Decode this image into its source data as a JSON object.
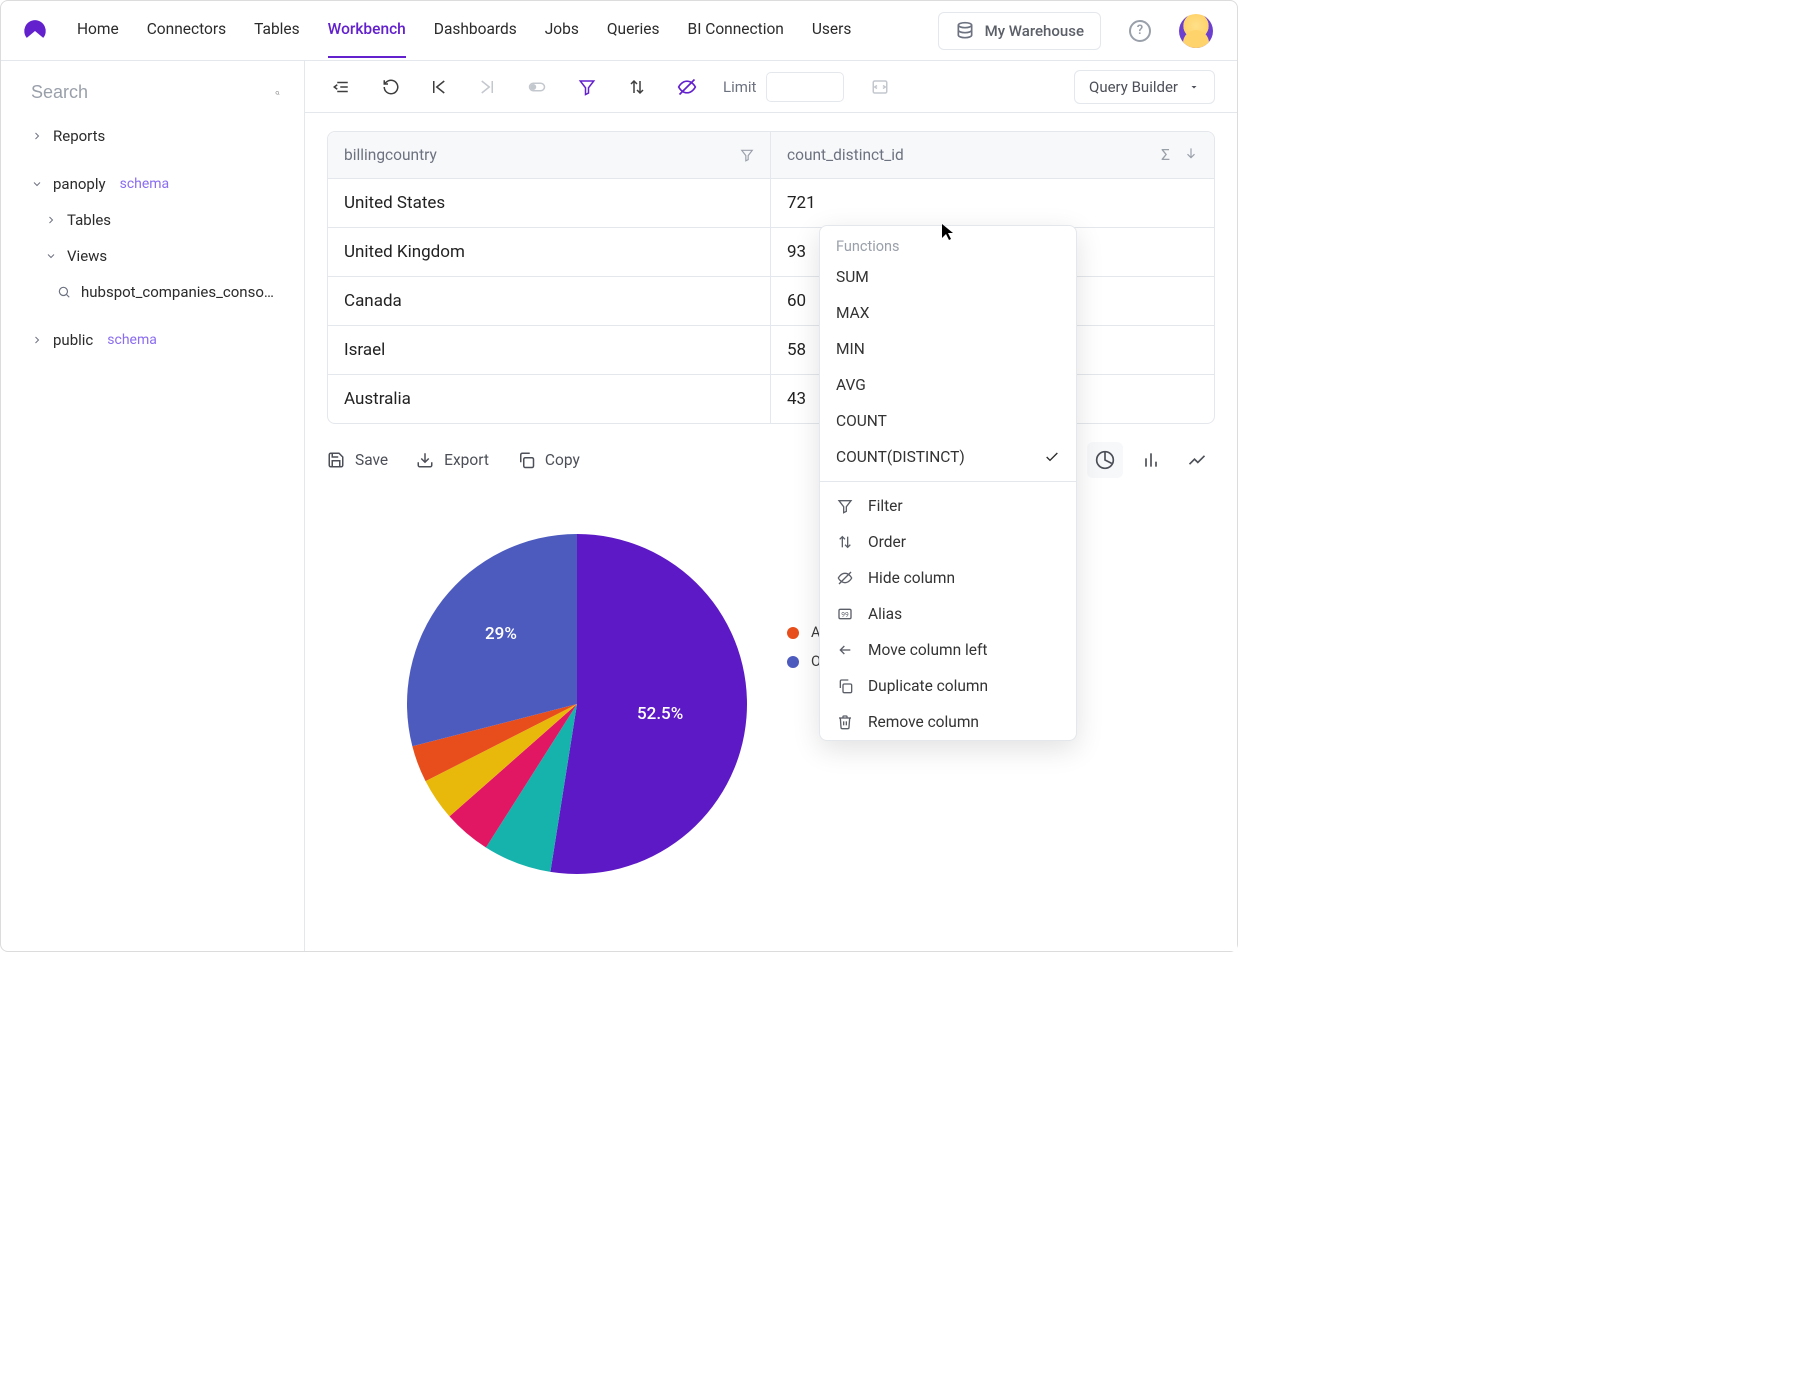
{
  "header": {
    "nav": [
      "Home",
      "Connectors",
      "Tables",
      "Workbench",
      "Dashboards",
      "Jobs",
      "Queries",
      "BI Connection",
      "Users"
    ],
    "active_nav": "Workbench",
    "warehouse_label": "My Warehouse"
  },
  "sidebar": {
    "search_placeholder": "Search",
    "tree": {
      "reports": "Reports",
      "panoply": "panoply",
      "schema_tag": "schema",
      "tables": "Tables",
      "views": "Views",
      "view_item": "hubspot_companies_conso…",
      "public": "public"
    }
  },
  "toolbar": {
    "limit_label": "Limit",
    "limit_value": "",
    "query_builder_label": "Query Builder"
  },
  "table": {
    "columns": {
      "country": "billingcountry",
      "count": "count_distinct_id"
    },
    "rows": [
      {
        "country": "United States",
        "count": "721"
      },
      {
        "country": "United Kingdom",
        "count": "93"
      },
      {
        "country": "Canada",
        "count": "60"
      },
      {
        "country": "Israel",
        "count": "58"
      },
      {
        "country": "Australia",
        "count": "43"
      }
    ]
  },
  "actions": {
    "save": "Save",
    "export": "Export",
    "copy": "Copy"
  },
  "chart_data": {
    "type": "pie",
    "title": "",
    "series": [
      {
        "name": "United States",
        "value": 52.5,
        "color": "#5C19C5"
      },
      {
        "name": "United Kingdom",
        "value": 6.5,
        "color": "#16B3AC"
      },
      {
        "name": "Canada",
        "value": 4.5,
        "color": "#E11763"
      },
      {
        "name": "Israel",
        "value": 4.0,
        "color": "#E8B90B"
      },
      {
        "name": "Australia",
        "value": 3.5,
        "color": "#E84E1B"
      },
      {
        "name": "Other",
        "value": 29.0,
        "color": "#4D5BBF"
      }
    ],
    "visible_labels": [
      {
        "text": "52.5%",
        "x": 230,
        "y": 170
      },
      {
        "text": "29%",
        "x": 78,
        "y": 90
      }
    ]
  },
  "legend_visible": [
    {
      "name": "Australia",
      "color": "#E84E1B"
    },
    {
      "name": "Other",
      "color": "#4D5BBF"
    }
  ],
  "popover": {
    "functions_title": "Functions",
    "functions": [
      "SUM",
      "MAX",
      "MIN",
      "AVG",
      "COUNT",
      "COUNT(DISTINCT)"
    ],
    "selected_function": "COUNT(DISTINCT)",
    "column_actions": [
      "Filter",
      "Order",
      "Hide column",
      "Alias",
      "Move column left",
      "Duplicate column",
      "Remove column"
    ]
  }
}
